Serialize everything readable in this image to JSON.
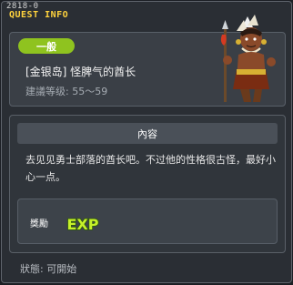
{
  "window": {
    "quest_id": "2818-0",
    "title": "QUEST INFO"
  },
  "quest": {
    "category": "一般",
    "name": "[金银岛] 怪脾气的酋长",
    "level_range": "建議等级: 55～59"
  },
  "content": {
    "header": "內容",
    "description": "去见见勇士部落的酋长吧。不过他的性格很古怪，最好小心一点。"
  },
  "reward": {
    "label": "獎勵",
    "exp_text": "EXP"
  },
  "status": {
    "text": "狀態:  可開始"
  },
  "colors": {
    "title": "#ffd33d",
    "category_pill": "#8fc31f",
    "exp": "#c6f02a"
  }
}
